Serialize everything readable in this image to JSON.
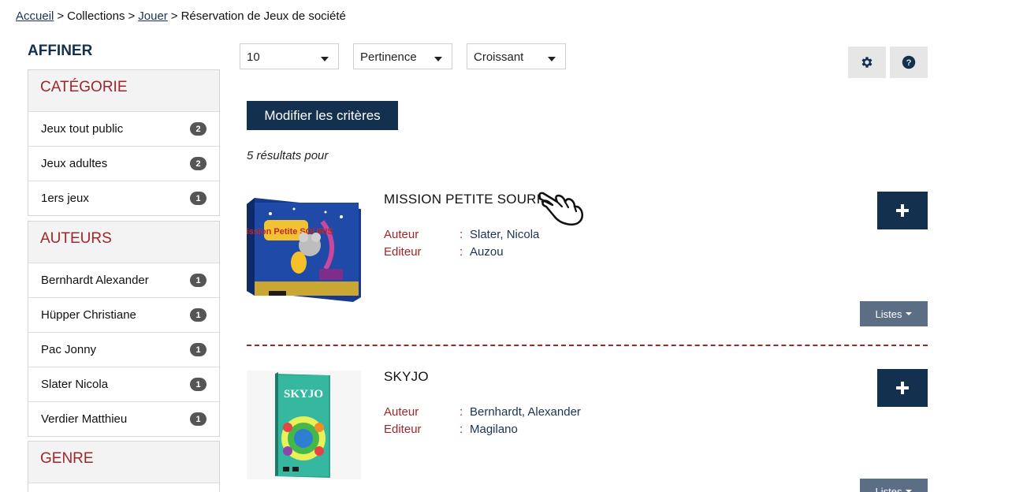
{
  "breadcrumb": {
    "home": "Accueil",
    "sep1": ">",
    "collections": "Collections",
    "sep2": ">",
    "jouer": "Jouer",
    "sep3": ">",
    "current": "Réservation de Jeux de société"
  },
  "sidebar": {
    "title": "AFFINER",
    "facets": [
      {
        "heading": "CATÉGORIE",
        "items": [
          {
            "label": "Jeux tout public",
            "count": "2"
          },
          {
            "label": "Jeux adultes",
            "count": "2"
          },
          {
            "label": "1ers jeux",
            "count": "1"
          }
        ]
      },
      {
        "heading": "AUTEURS",
        "items": [
          {
            "label": "Bernhardt Alexander",
            "count": "1"
          },
          {
            "label": "Hüpper Christiane",
            "count": "1"
          },
          {
            "label": "Pac Jonny",
            "count": "1"
          },
          {
            "label": "Slater Nicola",
            "count": "1"
          },
          {
            "label": "Verdier Matthieu",
            "count": "1"
          }
        ]
      },
      {
        "heading": "GENRE",
        "items": []
      }
    ]
  },
  "toolbar": {
    "per_page": "10",
    "sort_by": "Pertinence",
    "order": "Croissant",
    "settings_icon": "gear-icon",
    "help_icon": "question-circle-icon"
  },
  "search": {
    "modify_label": "Modifier les critères",
    "results_label": "5 résultats pour"
  },
  "results": [
    {
      "title": "MISSION PETITE SOURIS",
      "author_label": "Auteur",
      "author": "Slater, Nicola",
      "publisher_label": "Editeur",
      "publisher": "Auzou",
      "lists_label": "Listes",
      "cover_text": "Mission Petite SOURIS"
    },
    {
      "title": "SKYJO",
      "author_label": "Auteur",
      "author": "Bernhardt, Alexander",
      "publisher_label": "Editeur",
      "publisher": "Magilano",
      "lists_label": "Listes",
      "cover_text": "SKYJO"
    }
  ],
  "colors": {
    "navy": "#14304f",
    "red": "#a0262a",
    "slate": "#5b6e86"
  }
}
